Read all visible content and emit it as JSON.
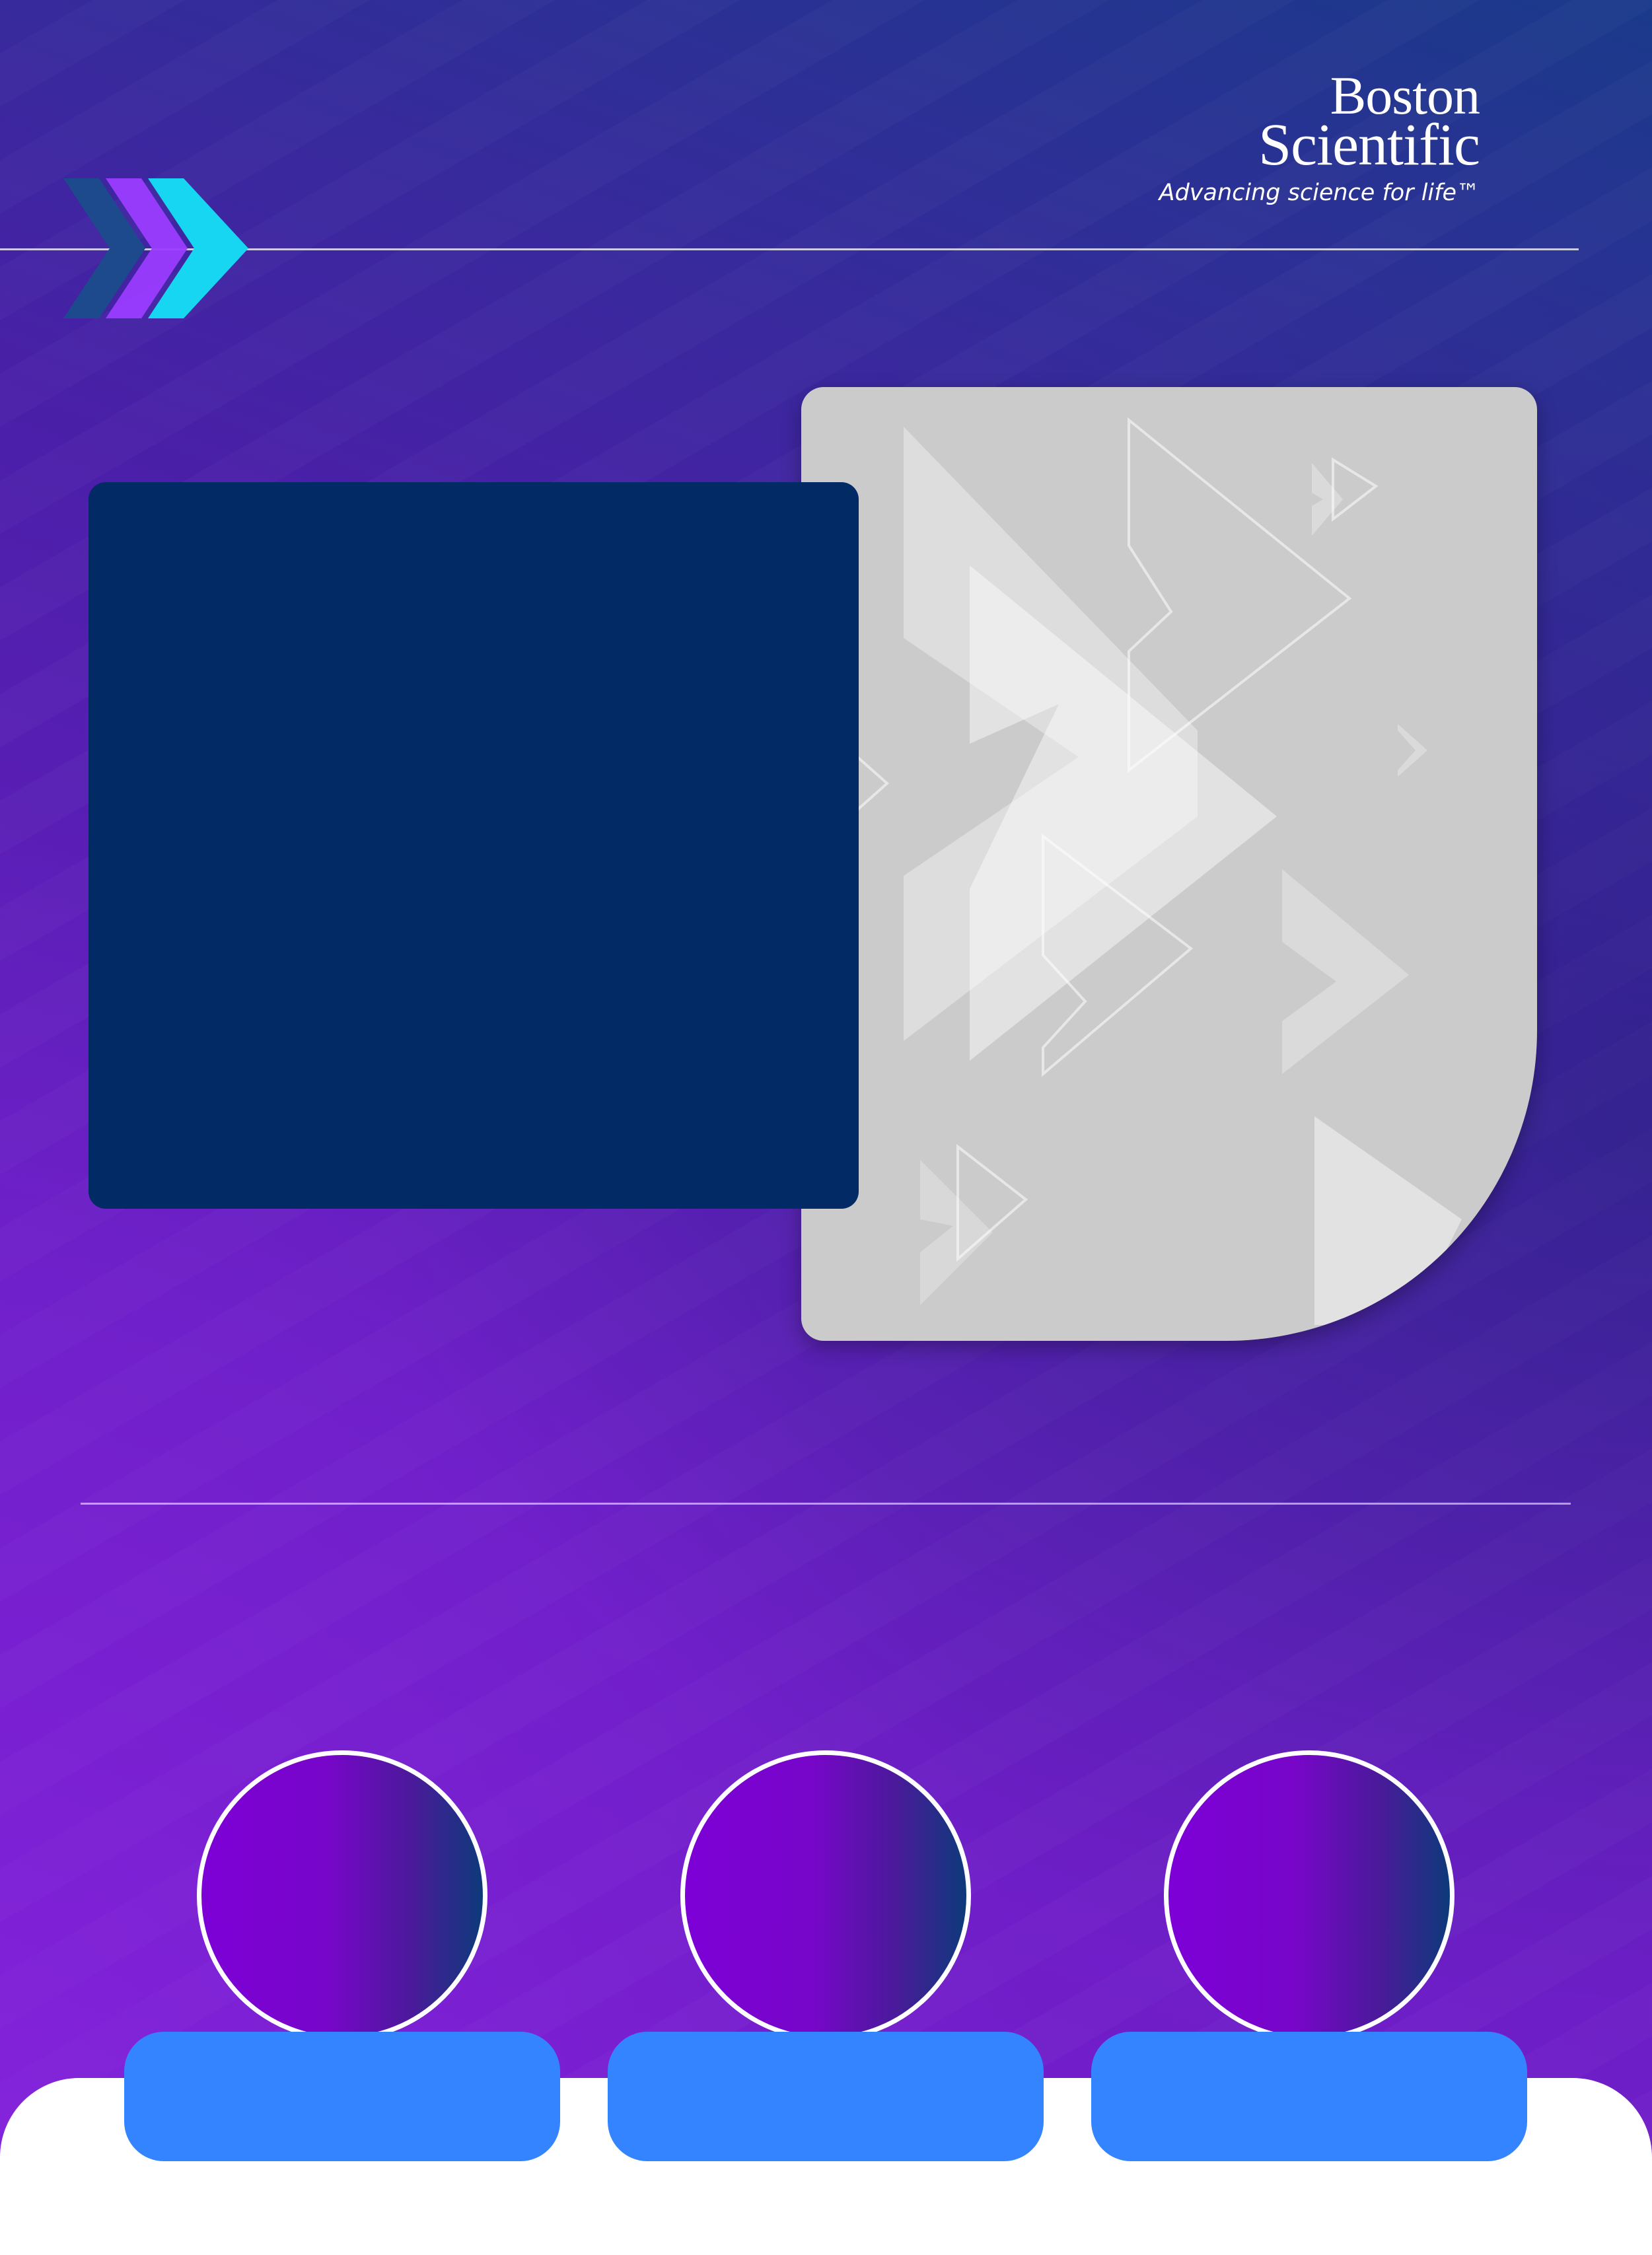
{
  "brand": {
    "name_line1": "Boston",
    "name_line2": "Scientific",
    "tagline": "Advancing science for life™"
  },
  "header": {
    "arrows_icon": "triple-chevron-right-icon"
  },
  "colors": {
    "background_start": "#7b1cd0",
    "background_end": "#1a3a8a",
    "navy_box": "#022a64",
    "gray_panel": "#cbcbcb",
    "pill_blue": "#3584ff",
    "chevron_dark_blue": "#1d4a8c",
    "chevron_purple": "#9b3cff",
    "chevron_cyan": "#16d6f2"
  },
  "circles": [
    {
      "icon": "circle-placeholder"
    },
    {
      "icon": "circle-placeholder"
    },
    {
      "icon": "circle-placeholder"
    }
  ],
  "pills": [
    {
      "label": ""
    },
    {
      "label": ""
    },
    {
      "label": ""
    }
  ]
}
